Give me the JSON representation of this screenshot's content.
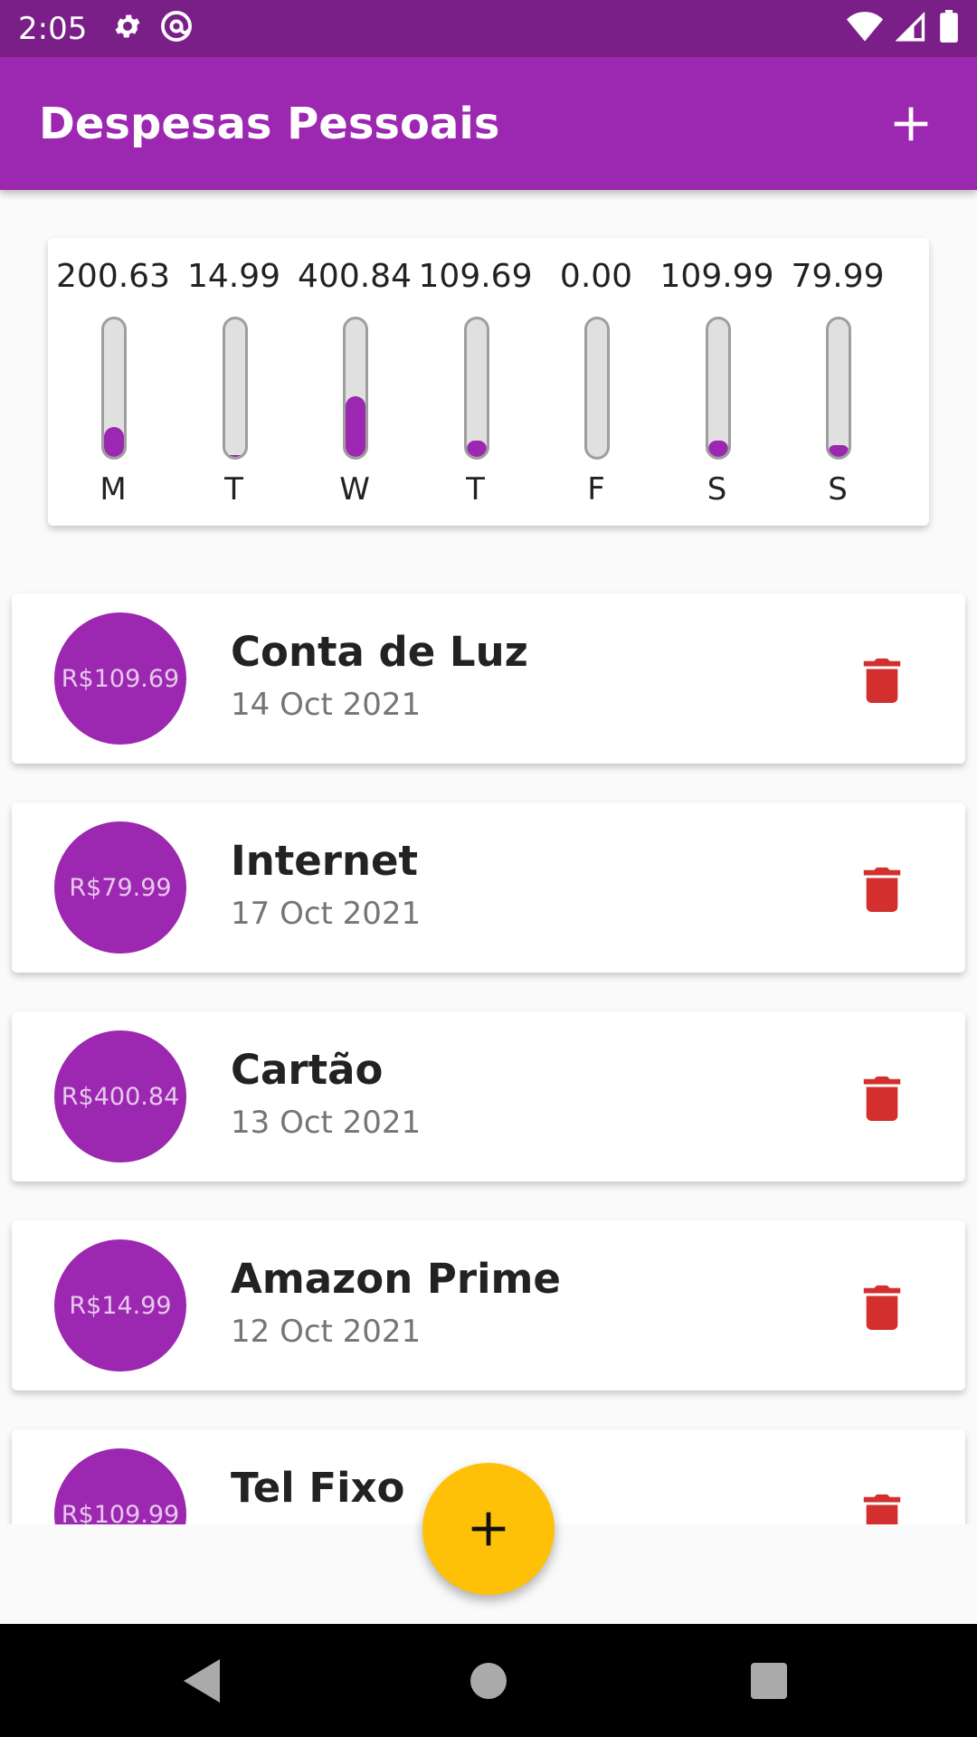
{
  "status_bar": {
    "time": "2:05",
    "icons": [
      "gear-icon",
      "at-sign-icon",
      "wifi-icon",
      "signal-icon",
      "battery-icon"
    ]
  },
  "app_bar": {
    "title": "Despesas Pessoais",
    "add_icon": "plus-icon"
  },
  "colors": {
    "primary": "#9c27b0",
    "primary_dark": "#7b1f88",
    "accent": "#ffc107",
    "delete": "#d32f2f"
  },
  "chart_data": {
    "type": "bar",
    "categories": [
      "M",
      "T",
      "W",
      "T",
      "F",
      "S",
      "S"
    ],
    "values": [
      200.63,
      14.99,
      400.84,
      109.69,
      0.0,
      109.99,
      79.99
    ],
    "labels": [
      "200.63",
      "14.99",
      "400.84",
      "109.69",
      "0.00",
      "109.99",
      "79.99"
    ],
    "fill_fraction": [
      0.22,
      0.016,
      0.44,
      0.12,
      0.0,
      0.12,
      0.088
    ]
  },
  "transactions": [
    {
      "amount": "R$109.69",
      "title": "Conta de Luz",
      "date": "14 Oct 2021"
    },
    {
      "amount": "R$79.99",
      "title": "Internet",
      "date": "17 Oct 2021"
    },
    {
      "amount": "R$400.84",
      "title": "Cartão",
      "date": "13 Oct 2021"
    },
    {
      "amount": "R$14.99",
      "title": "Amazon Prime",
      "date": "12 Oct 2021"
    },
    {
      "amount": "R$109.99",
      "title": "Tel Fixo",
      "date": ""
    }
  ],
  "fab": {
    "icon": "plus-icon"
  },
  "nav_bar": {
    "icons": [
      "back-icon",
      "home-icon",
      "recents-icon"
    ]
  }
}
